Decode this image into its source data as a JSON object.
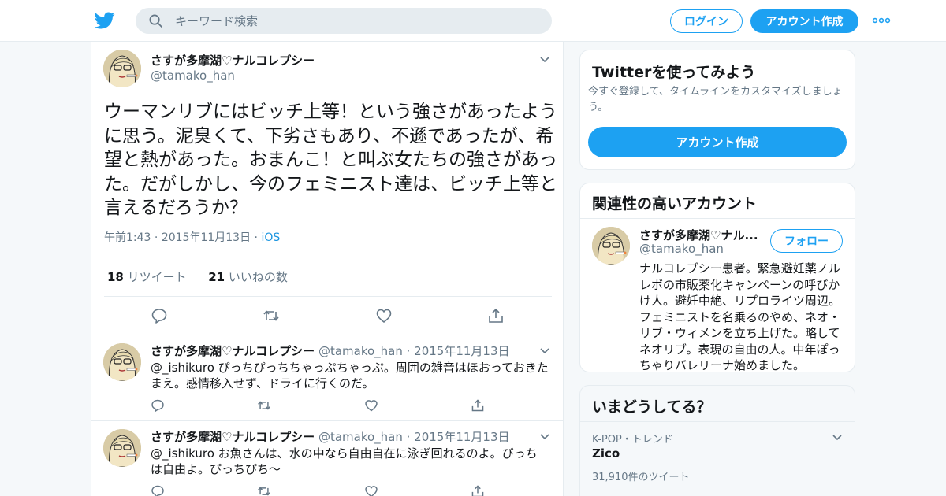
{
  "header": {
    "search_placeholder": "キーワード検索",
    "login_label": "ログイン",
    "signup_label": "アカウント作成",
    "logo_icon": "twitter-bird-icon",
    "accent": "#1da1f2"
  },
  "main_tweet": {
    "name": "さすが多摩湖♡ナルコレプシー",
    "handle": "@tamako_han",
    "text": "ウーマンリブにはビッチ上等！という強さがあったように思う。泥臭くて、下劣さもあり、不遜であったが、希望と熱があった。おまんこ！と叫ぶ女たちの強さがあった。だがしかし、今のフェミニスト達は、ビッチ上等と言えるだろうか？",
    "time": "午前1:43",
    "date": "2015年11月13日",
    "via": "iOS",
    "retweet_count": "18",
    "retweet_label": "リツイート",
    "like_count": "21",
    "like_label": "いいねの数"
  },
  "replies": [
    {
      "name": "さすが多摩湖♡ナルコレプシー",
      "handle": "@tamako_han",
      "date": "2015年11月13日",
      "text": "@_ishikuro ぴっちぴっちちゃっぷちゃっぷ。周囲の雑音はほおっておきたまえ。感情移入せず、ドライに行くのだ。"
    },
    {
      "name": "さすが多摩湖♡ナルコレプシー",
      "handle": "@tamako_han",
      "date": "2015年11月13日",
      "text": "@_ishikuro お魚さんは、水の中なら自由自在に泳ぎ回れるのよ。びっちは自由よ。ぴっちぴち〜"
    }
  ],
  "signup_card": {
    "title": "Twitterを使ってみよう",
    "subtitle": "今すぐ登録して、タイムラインをカスタマイズしましょう。",
    "button_label": "アカウント作成"
  },
  "related_card": {
    "title": "関連性の高いアカウント",
    "name": "さすが多摩湖♡ナル...",
    "handle": "@tamako_han",
    "follow_label": "フォロー",
    "bio": "ナルコレプシー患者。緊急避妊薬ノルレボの市販薬化キャンペーンの呼びかけ人。避妊中絶、リプロライツ周辺。フェミニストを名乗るのやめ、ネオ・リブ・ウィメンを立ち上げた。略してネオリブ。表現の自由の人。中年ぽっちゃりバレリーナ始めました。"
  },
  "trends_card": {
    "title": "いまどうしてる？",
    "trend_meta": "K-POP・トレンド",
    "trend_name": "Zico",
    "trend_count": "31,910件のツイート"
  }
}
